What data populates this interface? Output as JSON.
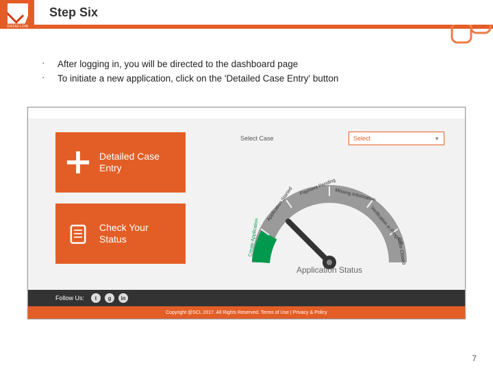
{
  "brand": "DATAFLOW",
  "title": "Step Six",
  "bullets": [
    "After logging in, you will be directed to the dashboard page",
    "To initiate a new application, click on the 'Detailed Case Entry' button"
  ],
  "dashboard": {
    "buttons": [
      {
        "label": "Detailed Case Entry",
        "icon": "plus"
      },
      {
        "label": "Check Your Status",
        "icon": "clipboard"
      }
    ],
    "select_case_label": "Select Case",
    "select_placeholder": "Select",
    "gauge": {
      "title": "Application Status",
      "segments": [
        "Create Application",
        "Application Started",
        "Payment Pending",
        "Missing Information",
        "Verification in Progress",
        "Case Closed"
      ]
    },
    "footer": {
      "follow_label": "Follow Us:",
      "copyright": "Copyright @SCL 2017. All Rights Reserved. Terms of Use  |  Privacy & Policy"
    }
  },
  "page_number": "7"
}
